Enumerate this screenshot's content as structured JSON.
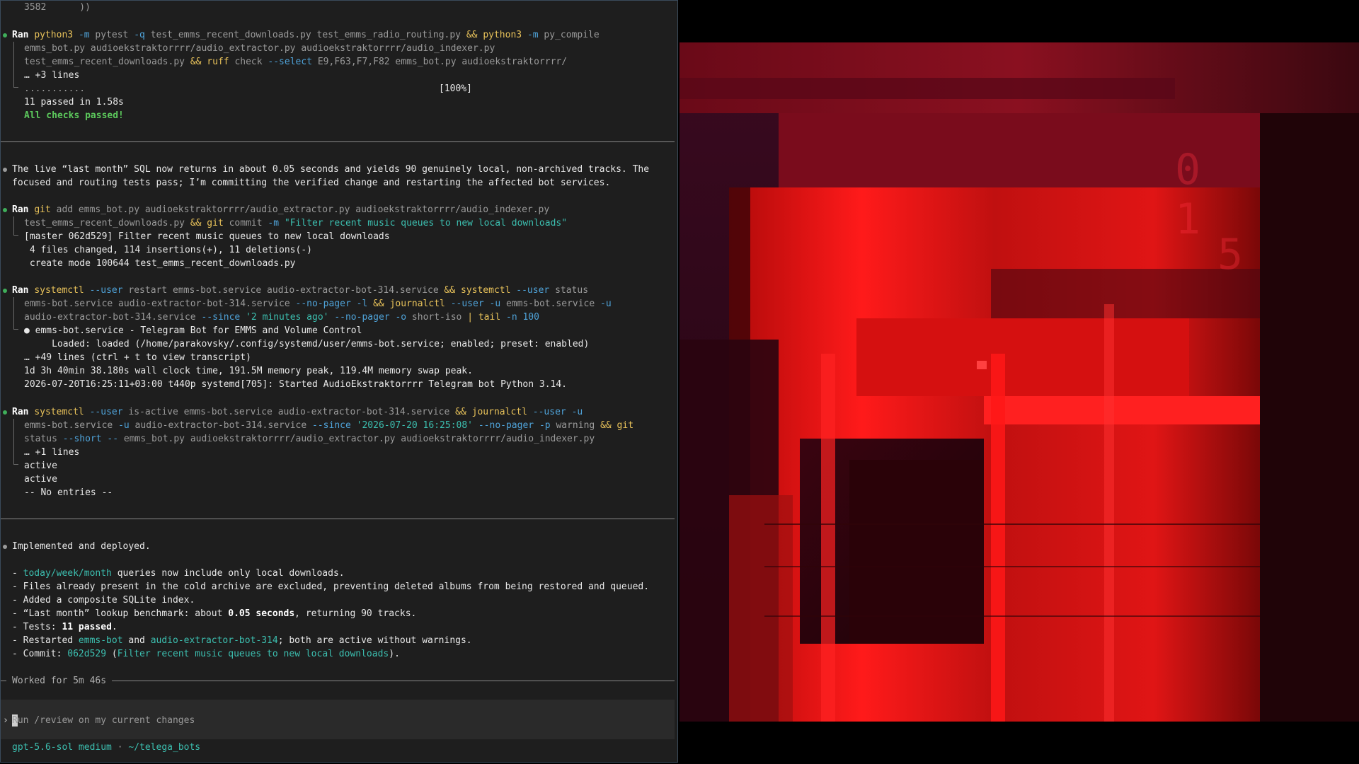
{
  "scroll_top_fragment": "3582      ))",
  "blocks": {
    "ran_tests": {
      "label": "Ran",
      "cmd1": "python3",
      "cmd1_flag": "-m",
      "cmd1_text": "pytest",
      "cmd1_flag2": "-q",
      "cmd1_files": "test_emms_recent_downloads.py test_emms_radio_routing.py",
      "op1": "&&",
      "cmd2": "python3",
      "cmd2_flag": "-m",
      "cmd2_text": "py_compile",
      "line2": "emms_bot.py audioekstraktorrrr/audio_extractor.py audioekstraktorrrr/audio_indexer.py",
      "line3_file": "test_emms_recent_downloads.py",
      "op2": "&&",
      "cmd3": "ruff",
      "cmd3_text": "check",
      "cmd3_flag": "--select",
      "cmd3_args": "E9,F63,F7,F82 emms_bot.py audioekstraktorrrr/",
      "more": "… +3 lines",
      "dots": "...........",
      "percent": "[100%]",
      "passed": "11 passed in 1.58s",
      "all_passed": "All checks passed!"
    },
    "note_sql": {
      "line1": "The live “last month” SQL now returns in about 0.05 seconds and yields 90 genuinely local, non-archived tracks. The",
      "line2": "focused and routing tests pass; I’m committing the verified change and restarting the affected bot services."
    },
    "ran_git": {
      "label": "Ran",
      "cmd": "git",
      "cmd_text": "add emms_bot.py audioekstraktorrrr/audio_extractor.py audioekstraktorrrr/audio_indexer.py",
      "line2_file": "test_emms_recent_downloads.py",
      "op": "&&",
      "cmd2": "git",
      "cmd2_text": "commit",
      "cmd2_flag": "-m",
      "cmd2_msg": "\"Filter recent music queues to new local downloads\"",
      "out1": "[master 062d529] Filter recent music queues to new local downloads",
      "out2": " 4 files changed, 114 insertions(+), 11 deletions(-)",
      "out3": " create mode 100644 test_emms_recent_downloads.py"
    },
    "ran_restart": {
      "label": "Ran",
      "cmd": "systemctl",
      "flag1": "--user",
      "text1": "restart emms-bot.service audio-extractor-bot-314.service",
      "op1": "&&",
      "cmd2": "systemctl",
      "flag2": "--user",
      "text2": "status",
      "l2_text": "emms-bot.service audio-extractor-bot-314.service",
      "l2_flag1": "--no-pager",
      "l2_flag2": "-l",
      "l2_op": "&&",
      "l2_cmd": "journalctl",
      "l2_flag3": "--user",
      "l2_flag4": "-u",
      "l2_text2": "emms-bot.service",
      "l2_flag5": "-u",
      "l3_text": "audio-extractor-bot-314.service",
      "l3_flag1": "--since",
      "l3_str": "'2 minutes ago'",
      "l3_flag2": "--no-pager",
      "l3_flag3": "-o",
      "l3_text2": "short-iso",
      "l3_pipe": "|",
      "l3_cmd": "tail",
      "l3_flag4": "-n",
      "l3_num": "100",
      "out1": "● emms-bot.service - Telegram Bot for EMMS and Volume Control",
      "out2": "     Loaded: loaded (/home/parakovsky/.config/systemd/user/emms-bot.service; enabled; preset: enabled)",
      "more": "… +49 lines (ctrl + t to view transcript)",
      "out3": "1d 3h 40min 38.180s wall clock time, 191.5M memory peak, 119.4M memory swap peak.",
      "out4": "2026-07-20T16:25:11+03:00 t440p systemd[705]: Started AudioEkstraktorrrr Telegram bot Python 3.14."
    },
    "ran_active": {
      "label": "Ran",
      "cmd": "systemctl",
      "flag1": "--user",
      "text1": "is-active emms-bot.service audio-extractor-bot-314.service",
      "op1": "&&",
      "cmd2": "journalctl",
      "flag2": "--user",
      "flag3": "-u",
      "l2_text": "emms-bot.service",
      "l2_flag1": "-u",
      "l2_text2": "audio-extractor-bot-314.service",
      "l2_flag2": "--since",
      "l2_str": "'2026-07-20 16:25:08'",
      "l2_flag3": "--no-pager",
      "l2_flag4": "-p",
      "l2_text3": "warning",
      "l2_op": "&&",
      "l2_cmd": "git",
      "l3_text": "status",
      "l3_flag1": "--short",
      "l3_flag2": "--",
      "l3_files": "emms_bot.py audioekstraktorrrr/audio_extractor.py audioekstraktorrrr/audio_indexer.py",
      "more": "… +1 lines",
      "out1": "active",
      "out2": "active",
      "out3": "-- No entries --"
    },
    "summary": {
      "heading": "Implemented and deployed.",
      "i1_dash": "- ",
      "i1_hl": "today/week/month",
      "i1_rest": " queries now include only local downloads.",
      "i2": "- Files already present in the cold archive are excluded, preventing deleted albums from being restored and queued.",
      "i3": "- Added a composite SQLite index.",
      "i4_a": "- “Last month” lookup benchmark: about ",
      "i4_b": "0.05 seconds",
      "i4_c": ", returning 90 tracks.",
      "i5_a": "- Tests: ",
      "i5_b": "11 passed",
      "i5_c": ".",
      "i6_a": "- Restarted ",
      "i6_b": "emms-bot",
      "i6_c": " and ",
      "i6_d": "audio-extractor-bot-314",
      "i6_e": "; both are active without warnings.",
      "i7_a": "- Commit: ",
      "i7_b": "062d529",
      "i7_c": " (",
      "i7_d": "Filter recent music queues to new local downloads",
      "i7_e": ")."
    }
  },
  "worked": "Worked for 5m 46s",
  "input": {
    "arrow": "›",
    "placeholder": "Run /review on my current changes"
  },
  "status_bar": {
    "model": "gpt-5.6-sol medium",
    "sep": " · ",
    "path": "~/telega_bots"
  },
  "colors": {
    "terminal_bg": "#1e1e1e",
    "command": "#e8c25a",
    "flag": "#4fa3d9",
    "string": "#3cbfb0",
    "success": "#5cc85c",
    "art_red": "#e01010"
  }
}
